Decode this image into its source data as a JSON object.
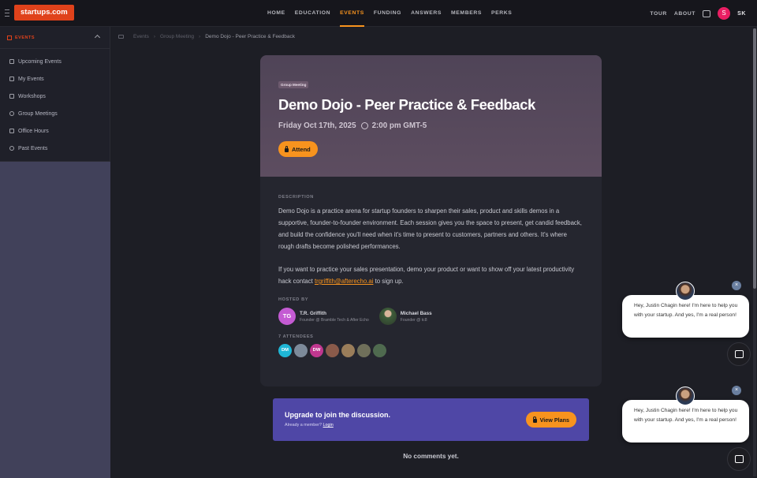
{
  "header": {
    "logo": "startups.com",
    "nav": [
      {
        "label": "HOME"
      },
      {
        "label": "EDUCATION"
      },
      {
        "label": "EVENTS"
      },
      {
        "label": "FUNDING"
      },
      {
        "label": "ANSWERS"
      },
      {
        "label": "MEMBERS"
      },
      {
        "label": "PERKS"
      }
    ],
    "active_nav": "EVENTS",
    "tour": "TOUR",
    "about": "ABOUT",
    "avatar_initial": "S",
    "user_initials": "SK"
  },
  "sidebar": {
    "section": "EVENTS",
    "items": [
      {
        "label": "Upcoming Events",
        "icon": "calendar-icon"
      },
      {
        "label": "My Events",
        "icon": "calendar-check-icon"
      },
      {
        "label": "Workshops",
        "icon": "wrench-icon"
      },
      {
        "label": "Group Meetings",
        "icon": "users-icon"
      },
      {
        "label": "Office Hours",
        "icon": "phone-icon"
      },
      {
        "label": "Past Events",
        "icon": "clock-icon"
      }
    ]
  },
  "breadcrumb": [
    "Events",
    "Group Meeting",
    "Demo Dojo - Peer Practice & Feedback"
  ],
  "event": {
    "tag": "Group Meeting",
    "title": "Demo Dojo - Peer Practice & Feedback",
    "date": "Friday Oct 17th, 2025",
    "time": "2:00 pm GMT-5",
    "attend_label": "Attend",
    "description_label": "DESCRIPTION",
    "description_p1": "Demo Dojo is a practice arena for startup founders to sharpen their sales, product and skills demos in a supportive, founder-to-founder environment. Each session gives you the space to present, get candid feedback, and build the confidence you'll need when it's time to present to customers, partners and others. It's where rough drafts become polished performances.",
    "description_p2_before": "If you want to practice your sales presentation, demo your product or want to show off your latest productivity hack contact ",
    "description_email": "trgriffith@afterecho.ai",
    "description_p2_after": " to sign up.",
    "hosted_label": "HOSTED BY",
    "hosts": [
      {
        "initials": "TG",
        "name": "T.R. Griffith",
        "role": "Founder @ Bramble Tech & After Echo"
      },
      {
        "initials": "",
        "name": "Michael Bass",
        "role": "Founder @ tc8"
      }
    ],
    "attendees_label": "7 ATTENDEES",
    "attendees": [
      {
        "initials": "DM",
        "color": "#1fb6d6"
      },
      {
        "initials": "",
        "color": "#7d8a9a"
      },
      {
        "initials": "DW",
        "color": "#c0378f"
      },
      {
        "initials": "",
        "color": "#8a5a4a"
      },
      {
        "initials": "",
        "color": "#9a7d5a"
      },
      {
        "initials": "",
        "color": "#6f6f5a"
      },
      {
        "initials": "",
        "color": "#4f6a4f"
      }
    ]
  },
  "upgrade": {
    "title": "Upgrade to join the discussion.",
    "sub": "Already a member?",
    "login": "Login",
    "button": "View Plans"
  },
  "comments": {
    "empty": "No comments yet."
  },
  "chat": {
    "message": "Hey, Justin Chagin here! I'm here to help you with your startup. And yes, I'm a real person!",
    "close": "×"
  },
  "colors": {
    "accent": "#f7931e",
    "brand": "#e0421b",
    "upgrade_bg": "#4f47a6"
  }
}
